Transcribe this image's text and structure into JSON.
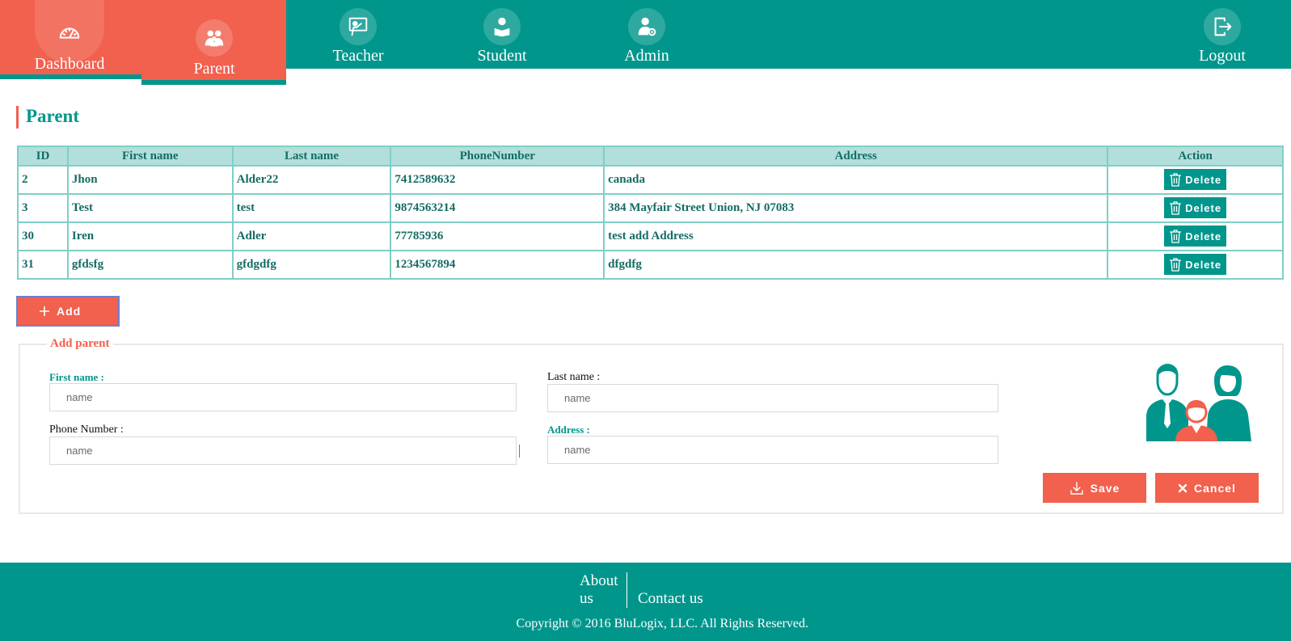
{
  "nav": {
    "items": [
      {
        "label": "Dashboard",
        "icon": "speedometer-icon"
      },
      {
        "label": "Parent",
        "icon": "parent-group-icon"
      },
      {
        "label": "Teacher",
        "icon": "teacher-board-icon"
      },
      {
        "label": "Student",
        "icon": "student-reading-icon"
      },
      {
        "label": "Admin",
        "icon": "admin-user-gear-icon"
      }
    ],
    "logout": {
      "label": "Logout",
      "icon": "logout-icon"
    }
  },
  "page": {
    "title": "Parent"
  },
  "table": {
    "columns": [
      "ID",
      "First name",
      "Last name",
      "PhoneNumber",
      "Address",
      "Action"
    ],
    "rows": [
      {
        "id": "2",
        "first": "Jhon",
        "last": "Alder22",
        "phone": "7412589632",
        "address": "canada",
        "action": "Delete"
      },
      {
        "id": "3",
        "first": "Test",
        "last": "test",
        "phone": "9874563214",
        "address": "384 Mayfair Street Union, NJ 07083",
        "action": "Delete"
      },
      {
        "id": "30",
        "first": "Iren",
        "last": "Adler",
        "phone": "77785936",
        "address": "test add Address",
        "action": "Delete"
      },
      {
        "id": "31",
        "first": "gfdsfg",
        "last": "gfdgdfg",
        "phone": "1234567894",
        "address": "dfgdfg",
        "action": "Delete"
      }
    ]
  },
  "add_button": {
    "label": "Add"
  },
  "form": {
    "legend": "Add parent",
    "first_name": {
      "label": "First name :",
      "placeholder": "name",
      "value": ""
    },
    "last_name": {
      "label": "Last name :",
      "placeholder": "name",
      "value": ""
    },
    "phone": {
      "label": "Phone Number :",
      "placeholder": "name",
      "value": ""
    },
    "address": {
      "label": "Address :",
      "placeholder": "name",
      "value": ""
    },
    "save_label": "Save",
    "cancel_label": "Cancel"
  },
  "footer": {
    "about_line1": "About",
    "about_line2": "us",
    "contact": "Contact us",
    "copyright": "Copyright © 2016 BluLogix, LLC. All Rights Reserved."
  },
  "colors": {
    "teal": "#00968c",
    "coral": "#f2604e",
    "table_header": "#b2dfdb",
    "table_border": "#7fcfc7"
  }
}
